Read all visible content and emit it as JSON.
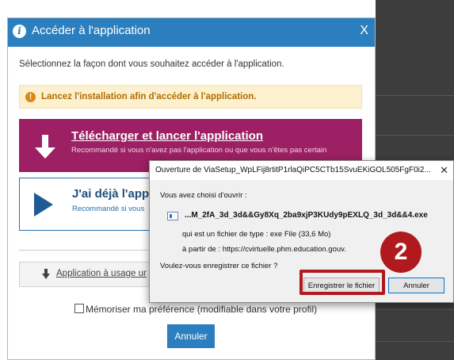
{
  "modal": {
    "title": "Accéder à l'application",
    "close": "X",
    "intro": "Sélectionnez la façon dont vous souhaitez accéder à l'application.",
    "alert": "Lancez l'installation afin d'accéder à l'application.",
    "download": {
      "label": "Télécharger et lancer l'application",
      "sublabel": "Recommandé si vous n'avez pas l'application ou que vous n'êtes pas certain"
    },
    "installed": {
      "label": "J'ai déjà l'app",
      "sublabel": "Recommandé si vous"
    },
    "usage_link": "Application à usage ur",
    "remember": "Mémoriser ma préférence (modifiable dans votre profil)",
    "cancel": "Annuler"
  },
  "dialog": {
    "title": "Ouverture de ViaSetup_WpLFij8rtitP1rlaQiPC5CTb15SvuEKiGOL505FgF0i2...",
    "close": "✕",
    "opening": "Vous avez choisi d'ouvrir :",
    "filename": "...M_2fA_3d_3d&&Gy8Xq_2ba9xjP3KUdy9pEXLQ_3d_3d&&4.exe",
    "filetype": "qui est un fichier de type : exe File (33,6 Mo)",
    "from": "à partir de : https://cvirtuelle.phm.education.gouv.",
    "question": "Voulez-vous enregistrer ce fichier ?",
    "save": "Enregistrer le fichier",
    "cancel": "Annuler"
  },
  "annotation": {
    "step": "2",
    "color": "#b01a1f"
  },
  "colors": {
    "header_blue": "#2c7fbf",
    "download_magenta": "#9c2063",
    "alert_bg": "#fcf0cf",
    "alert_text": "#b26e00"
  }
}
